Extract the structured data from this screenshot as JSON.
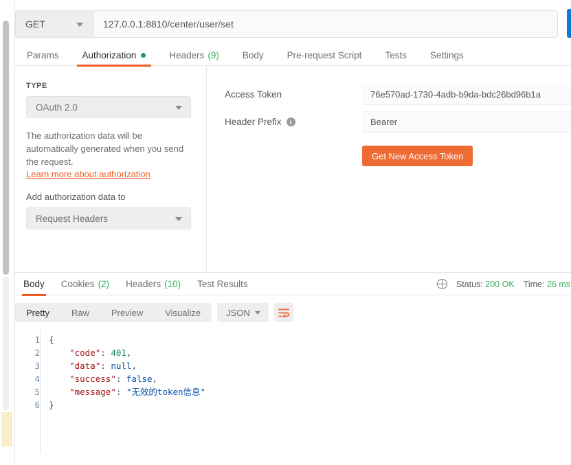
{
  "request": {
    "method": "GET",
    "url": "127.0.0.1:8810/center/user/set",
    "tabs": [
      {
        "label": "Params",
        "count": null,
        "dot": false,
        "active": false
      },
      {
        "label": "Authorization",
        "count": null,
        "dot": true,
        "active": true
      },
      {
        "label": "Headers",
        "count": "(9)",
        "dot": false,
        "active": false
      },
      {
        "label": "Body",
        "count": null,
        "dot": false,
        "active": false
      },
      {
        "label": "Pre-request Script",
        "count": null,
        "dot": false,
        "active": false
      },
      {
        "label": "Tests",
        "count": null,
        "dot": false,
        "active": false
      },
      {
        "label": "Settings",
        "count": null,
        "dot": false,
        "active": false
      }
    ]
  },
  "auth": {
    "type_label": "TYPE",
    "type_value": "OAuth 2.0",
    "description": "The authorization data will be automatically generated when you send the request.",
    "learn_more": "Learn more about authorization",
    "add_to_label": "Add authorization data to",
    "add_to_value": "Request Headers",
    "fields": [
      {
        "label": "Access Token",
        "value": "76e570ad-1730-4adb-b9da-bdc26bd96b1a",
        "info": false
      },
      {
        "label": "Header Prefix",
        "value": "Bearer",
        "info": true
      }
    ],
    "get_token_button": "Get New Access Token"
  },
  "response": {
    "tabs": [
      {
        "label": "Body",
        "count": null,
        "active": true
      },
      {
        "label": "Cookies",
        "count": "(2)",
        "active": false
      },
      {
        "label": "Headers",
        "count": "(10)",
        "active": false
      },
      {
        "label": "Test Results",
        "count": null,
        "active": false
      }
    ],
    "status_label": "Status:",
    "status_value": "200 OK",
    "time_label": "Time:",
    "time_value": "26 ms",
    "view_modes": [
      "Pretty",
      "Raw",
      "Preview",
      "Visualize"
    ],
    "active_view_mode": "Pretty",
    "format": "JSON",
    "body_lines": [
      {
        "n": "1",
        "html": "<span class=\"c-punc\">{</span>"
      },
      {
        "n": "2",
        "html": "    <span class=\"c-key\">\"code\"</span><span class=\"c-punc\">: </span><span class=\"c-num\">401</span><span class=\"c-punc\">,</span>"
      },
      {
        "n": "3",
        "html": "    <span class=\"c-key\">\"data\"</span><span class=\"c-punc\">: </span><span class=\"c-null\">null</span><span class=\"c-punc\">,</span>"
      },
      {
        "n": "4",
        "html": "    <span class=\"c-key\">\"success\"</span><span class=\"c-punc\">: </span><span class=\"c-bool\">false</span><span class=\"c-punc\">,</span>"
      },
      {
        "n": "5",
        "html": "    <span class=\"c-key\">\"message\"</span><span class=\"c-punc\">: </span><span class=\"c-str\">\"无效的token信息\"</span>"
      },
      {
        "n": "6",
        "html": "<span class=\"c-punc\">}</span>"
      }
    ]
  },
  "colors": {
    "accent_orange": "#ef5b25",
    "button_orange": "#ee6b33",
    "status_green": "#3aaf5c",
    "send_blue": "#0e77d2",
    "highlight_yellow": "#fbeecb"
  }
}
